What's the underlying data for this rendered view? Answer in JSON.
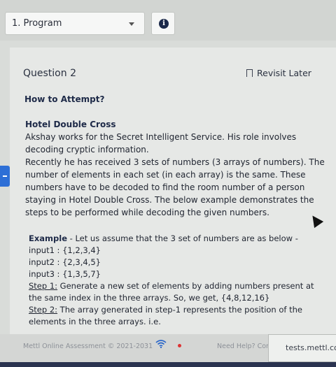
{
  "top": {
    "section_select": "1. Program",
    "info_glyph": "i"
  },
  "question": {
    "title": "Question 2",
    "revisit_label": "Revisit Later",
    "how_to": "How to Attempt?"
  },
  "problem": {
    "heading": "Hotel Double Cross",
    "paragraph1": "Akshay works for the Secret Intelligent Service. His role involves decoding cryptic information.",
    "paragraph2": "Recently he has received 3 sets of numbers (3 arrays of numbers). The number of elements in each set (in each array) is the same. These numbers have to be decoded to find the room number of a person staying in Hotel Double Cross. The below example demonstrates the steps to be performed while decoding the given numbers."
  },
  "example": {
    "label": "Example",
    "intro": " - Let us assume that the 3 set of numbers are as below -",
    "input1": "input1 : {1,2,3,4}",
    "input2": "input2 : {2,3,4,5}",
    "input3": "input3 : {1,3,5,7}",
    "step1_label": "Step 1:",
    "step1_text": " Generate a new set of elements by adding numbers present at the same index in the three arrays. So, we get, {4,8,12,16}",
    "step2_label": "Step 2:",
    "step2_text": " The array generated in step-1 represents the position of the elements in the three arrays. i.e."
  },
  "footer": {
    "copyright": "Mettl Online Assessment © 2021-2031",
    "help": "Need Help? Cor",
    "url": "tests.mettl.co"
  },
  "colors": {
    "accent": "#2d6fd6",
    "heading": "#1e2a48",
    "background": "#d9dcd9"
  }
}
